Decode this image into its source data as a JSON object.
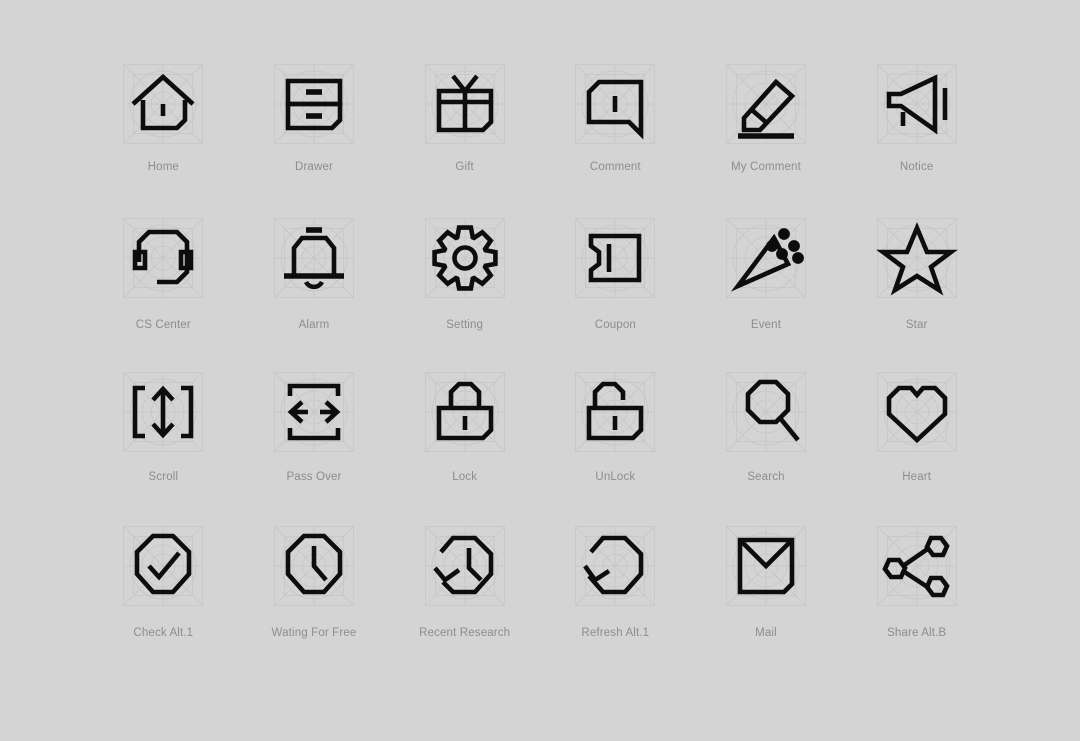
{
  "sheet": {
    "background_color": "#d4d4d4",
    "stroke_color": "#0d0d0d",
    "label_color": "#8d8d8d",
    "guide_color": "#c6c6c6",
    "columns": 6,
    "rows": 4,
    "total_icons": 24
  },
  "icons": [
    {
      "id": "home",
      "label": "Home",
      "icon_name": "home-icon"
    },
    {
      "id": "drawer",
      "label": "Drawer",
      "icon_name": "drawer-icon"
    },
    {
      "id": "gift",
      "label": "Gift",
      "icon_name": "gift-icon"
    },
    {
      "id": "comment",
      "label": "Comment",
      "icon_name": "comment-icon"
    },
    {
      "id": "my-comment",
      "label": "My Comment",
      "icon_name": "pencil-icon"
    },
    {
      "id": "notice",
      "label": "Notice",
      "icon_name": "megaphone-icon"
    },
    {
      "id": "cs-center",
      "label": "CS Center",
      "icon_name": "headset-icon"
    },
    {
      "id": "alarm",
      "label": "Alarm",
      "icon_name": "bell-icon"
    },
    {
      "id": "setting",
      "label": "Setting",
      "icon_name": "gear-icon"
    },
    {
      "id": "coupon",
      "label": "Coupon",
      "icon_name": "ticket-icon"
    },
    {
      "id": "event",
      "label": "Event",
      "icon_name": "party-popper-icon"
    },
    {
      "id": "star",
      "label": "Star",
      "icon_name": "star-icon"
    },
    {
      "id": "scroll",
      "label": "Scroll",
      "icon_name": "vertical-arrows-icon"
    },
    {
      "id": "pass-over",
      "label": "Pass Over",
      "icon_name": "horizontal-arrows-icon"
    },
    {
      "id": "lock",
      "label": "Lock",
      "icon_name": "lock-icon"
    },
    {
      "id": "unlock",
      "label": "UnLock",
      "icon_name": "unlock-icon"
    },
    {
      "id": "search",
      "label": "Search",
      "icon_name": "magnifier-icon"
    },
    {
      "id": "heart",
      "label": "Heart",
      "icon_name": "heart-icon"
    },
    {
      "id": "check-alt-1",
      "label": "Check Alt.1",
      "icon_name": "check-circle-icon"
    },
    {
      "id": "wating-for-free",
      "label": "Wating For Free",
      "icon_name": "clock-icon"
    },
    {
      "id": "recent-research",
      "label": "Recent Research",
      "icon_name": "clock-rewind-icon"
    },
    {
      "id": "refresh-alt-1",
      "label": "Refresh Alt.1",
      "icon_name": "refresh-icon"
    },
    {
      "id": "mail",
      "label": "Mail",
      "icon_name": "envelope-icon"
    },
    {
      "id": "share-alt-b",
      "label": "Share Alt.B",
      "icon_name": "share-nodes-icon"
    }
  ]
}
